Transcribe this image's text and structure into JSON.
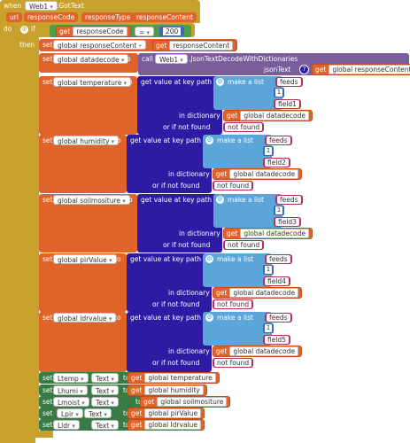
{
  "event": {
    "when": "when",
    "component": "Web1",
    "event_name": ".GotText",
    "params": [
      "url",
      "responseCode",
      "responseType",
      "responseContent"
    ],
    "do": "do"
  },
  "if_block": {
    "if": "if",
    "then": "then",
    "get": "get",
    "var": "responseCode",
    "op": "=",
    "num": "200"
  },
  "set_content": {
    "set": "set",
    "var": "global responseContent",
    "to": "to",
    "get": "get",
    "value": "responseContent"
  },
  "set_decode": {
    "set": "set",
    "var": "global datadecode",
    "to": "to",
    "call": "call",
    "comp": "Web1",
    "method": ".JsonTextDecodeWithDictionaries",
    "param": "jsonText",
    "get": "get",
    "value": "global responseContent"
  },
  "labels": {
    "set": "set",
    "to": "to",
    "get_value": "get value at key path",
    "make_list": "make a list",
    "in_dictionary": "in dictionary",
    "if_not_found": "or if not found",
    "get": "get",
    "datadecode": "global datadecode",
    "not_found": "not found"
  },
  "sensors": [
    {
      "var": "global temperature",
      "keys": [
        "feeds",
        "1",
        "field1"
      ]
    },
    {
      "var": "global humidity",
      "keys": [
        "feeds",
        "1",
        "field2"
      ]
    },
    {
      "var": "global soilmositure",
      "keys": [
        "feeds",
        "1",
        "field3"
      ]
    },
    {
      "var": "global pirValue",
      "keys": [
        "feeds",
        "1",
        "field4"
      ]
    },
    {
      "var": "global ldrvalue",
      "keys": [
        "feeds",
        "1",
        "field5"
      ]
    }
  ],
  "label_sets": [
    {
      "comp": "Ltemp",
      "prop": "Text",
      "value": "global temperature"
    },
    {
      "comp": "Lhumi",
      "prop": "Text",
      "value": "global humidity"
    },
    {
      "comp": "Lmoist",
      "prop": "Text",
      "value": "global soilmositure"
    },
    {
      "comp": "Lpir",
      "prop": "Text",
      "value": "global pirValue"
    },
    {
      "comp": "Lldr",
      "prop": "Text",
      "value": "global ldrvalue"
    }
  ]
}
